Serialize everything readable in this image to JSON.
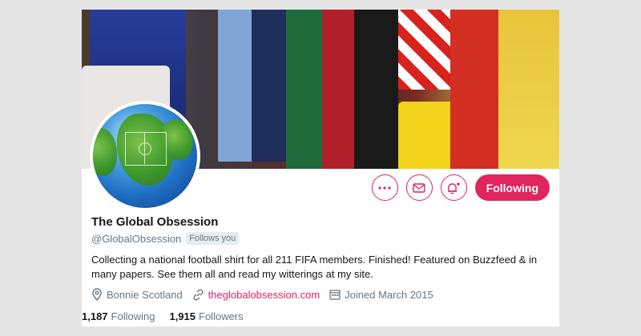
{
  "profile": {
    "display_name": "The Global Obsession",
    "handle": "@GlobalObsession",
    "follows_you_badge": "Follows you",
    "bio": "Collecting a national football shirt for all 211 FIFA members. Finished! Featured on Buzzfeed & in many papers. See them all and read my witterings at my site.",
    "location": "Bonnie Scotland",
    "website": "theglobalobsession.com",
    "joined": "Joined March 2015"
  },
  "stats": {
    "following_count": "1,187",
    "following_label": "Following",
    "followers_count": "1,915",
    "followers_label": "Followers"
  },
  "actions": {
    "more_icon": "more-icon",
    "message_icon": "envelope-icon",
    "notify_icon": "bell-plus-icon",
    "follow_label": "Following"
  },
  "colors": {
    "accent": "#e0245e",
    "secondary_text": "#657786"
  }
}
